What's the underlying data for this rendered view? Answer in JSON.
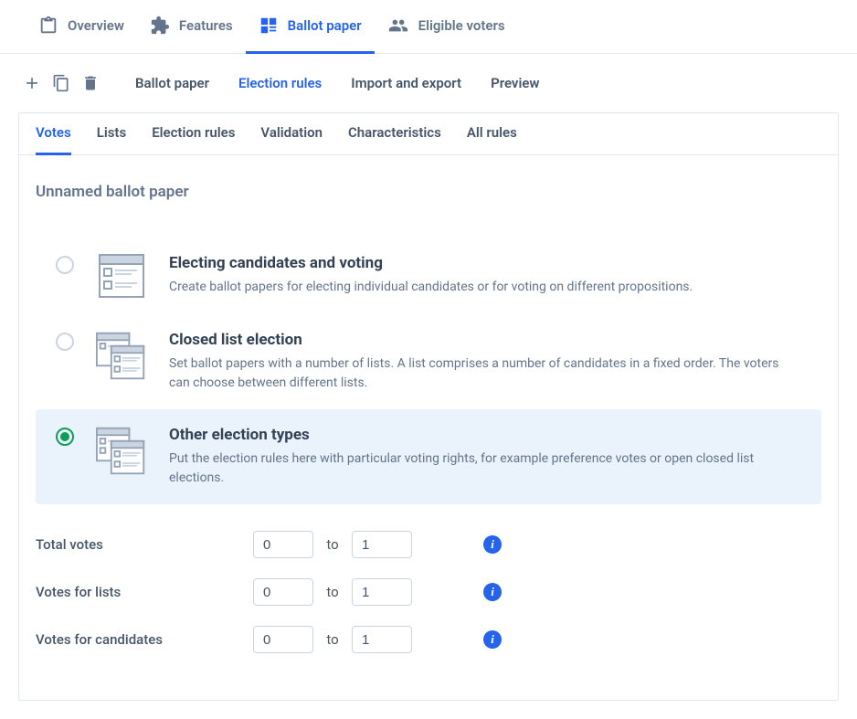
{
  "top_nav": [
    {
      "label": "Overview",
      "icon": "clipboard-icon",
      "active": false
    },
    {
      "label": "Features",
      "icon": "puzzle-icon",
      "active": false
    },
    {
      "label": "Ballot paper",
      "icon": "ballot-icon",
      "active": true
    },
    {
      "label": "Eligible voters",
      "icon": "people-icon",
      "active": false
    }
  ],
  "toolbar_icons": [
    {
      "name": "add-icon"
    },
    {
      "name": "copy-icon"
    },
    {
      "name": "delete-icon"
    }
  ],
  "sub_tabs": [
    {
      "label": "Ballot paper",
      "active": false
    },
    {
      "label": "Election rules",
      "active": true
    },
    {
      "label": "Import and export",
      "active": false
    },
    {
      "label": "Preview",
      "active": false
    }
  ],
  "inner_tabs": [
    {
      "label": "Votes",
      "active": true
    },
    {
      "label": "Lists",
      "active": false
    },
    {
      "label": "Election rules",
      "active": false
    },
    {
      "label": "Validation",
      "active": false
    },
    {
      "label": "Characteristics",
      "active": false
    },
    {
      "label": "All rules",
      "active": false
    }
  ],
  "ballot_title": "Unnamed ballot paper",
  "options": [
    {
      "title": "Electing candidates and voting",
      "desc": "Create ballot papers for electing individual candidates or for voting on different propositions.",
      "selected": false
    },
    {
      "title": "Closed list election",
      "desc": "Set ballot papers with a number of lists. A list comprises a number of candidates in a fixed order. The voters can choose between different lists.",
      "selected": false
    },
    {
      "title": "Other election types",
      "desc": "Put the election rules here with particular voting rights, for example preference votes or open closed list elections.",
      "selected": true
    }
  ],
  "rules": [
    {
      "label": "Total votes",
      "from": "0",
      "to_word": "to",
      "to": "1"
    },
    {
      "label": "Votes for lists",
      "from": "0",
      "to_word": "to",
      "to": "1"
    },
    {
      "label": "Votes for candidates",
      "from": "0",
      "to_word": "to",
      "to": "1"
    }
  ]
}
